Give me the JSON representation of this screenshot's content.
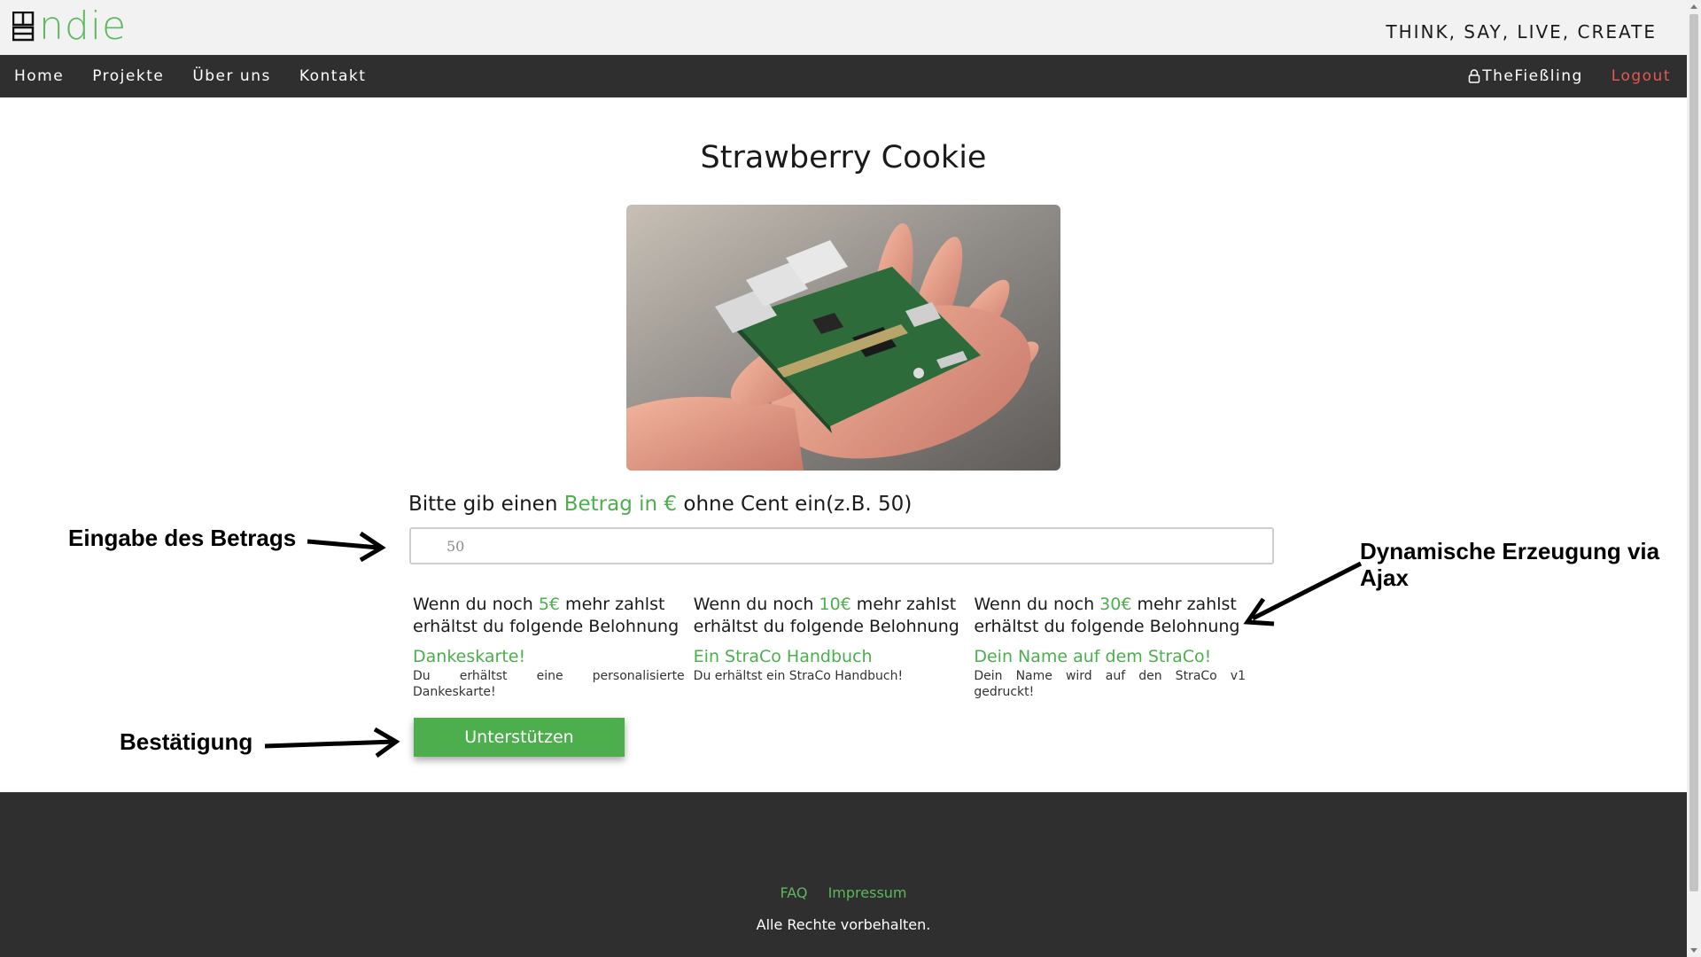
{
  "header": {
    "logo_text": "ndie",
    "tagline": "THINK, SAY, LIVE, CREATE"
  },
  "nav": {
    "items": [
      {
        "label": "Home"
      },
      {
        "label": "Projekte"
      },
      {
        "label": "Über uns"
      },
      {
        "label": "Kontakt"
      }
    ],
    "user_label": "TheFießling",
    "logout_label": "Logout"
  },
  "project": {
    "title": "Strawberry Cookie"
  },
  "amount_form": {
    "prompt_prefix": "Bitte gib einen ",
    "prompt_highlight": "Betrag in €",
    "prompt_suffix": " ohne Cent ein(z.B. 50)",
    "placeholder": "50"
  },
  "rewards": [
    {
      "head_prefix": "Wenn du noch ",
      "amount": "5€",
      "head_suffix": " mehr zahlst erhältst du folgende Belohnung",
      "title": "Dankeskarte!",
      "description": "Du erhältst eine personalisierte Dankeskarte!"
    },
    {
      "head_prefix": "Wenn du noch ",
      "amount": "10€",
      "head_suffix": " mehr zahlst erhältst du folgende Belohnung",
      "title": "Ein StraCo Handbuch",
      "description": "Du erhältst ein StraCo Handbuch!"
    },
    {
      "head_prefix": "Wenn du noch ",
      "amount": "30€",
      "head_suffix": " mehr zahlst erhältst du folgende Belohnung",
      "title": "Dein Name auf dem StraCo!",
      "description": "Dein Name wird auf den StraCo v1 gedruckt!"
    }
  ],
  "support_button": "Unterstützen",
  "annotations": {
    "input": "Eingabe des Betrags",
    "ajax": "Dynamische Erzeugung via Ajax",
    "confirm": "Bestätigung"
  },
  "footer": {
    "links": [
      {
        "label": "FAQ"
      },
      {
        "label": "Impressum"
      }
    ],
    "copyright": "Alle Rechte vorbehalten."
  },
  "colors": {
    "accent": "#4cae4c",
    "nav_bg": "#2f2f2f",
    "logout": "#e05a52"
  }
}
